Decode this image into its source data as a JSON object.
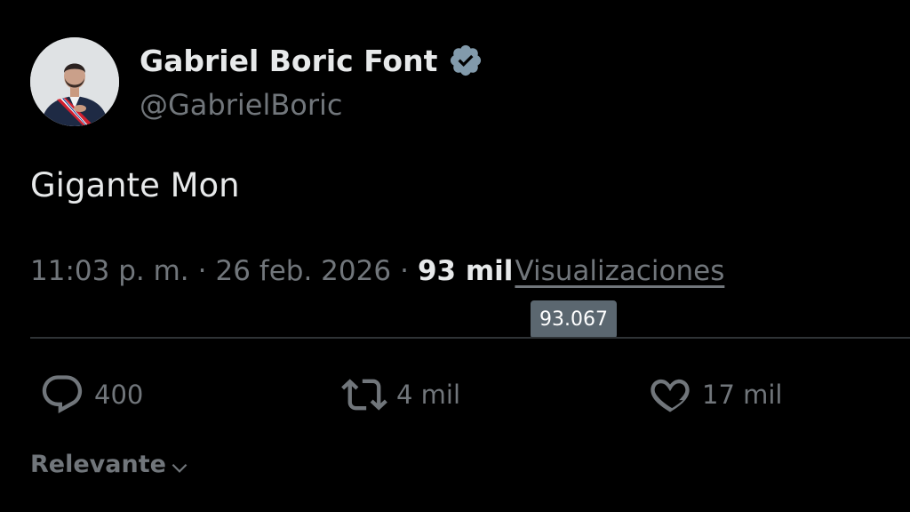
{
  "author": {
    "display_name": "Gabriel Boric Font",
    "handle": "@GabrielBoric",
    "verified": true
  },
  "tweet": {
    "text": "Gigante Mon"
  },
  "meta": {
    "time": "11:03 p. m.",
    "separator": "·",
    "date": "26 feb. 2026",
    "views_count": "93 mil",
    "views_label": "Visualizaciones"
  },
  "tooltip": {
    "text": "93.067"
  },
  "actions": {
    "replies": "400",
    "retweets": "4 mil",
    "likes": "17 mil"
  },
  "sort": {
    "label": "Relevante"
  },
  "icons": {
    "verified": "verified-badge-icon",
    "reply": "reply-icon",
    "retweet": "retweet-icon",
    "like": "heart-icon",
    "dropdown": "chevron-down-icon"
  },
  "colors": {
    "background": "#000000",
    "primary_text": "#e7e9ea",
    "secondary_text": "#71767b",
    "tooltip_bg": "#5b6770",
    "divider": "#2f3336"
  }
}
